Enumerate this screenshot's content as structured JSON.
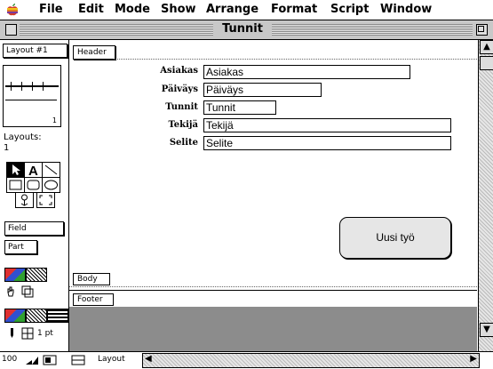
{
  "menubar": {
    "items": [
      "File",
      "Edit",
      "Mode",
      "Show",
      "Arrange",
      "Format",
      "Script",
      "Window"
    ]
  },
  "window": {
    "title": "Tunnit"
  },
  "tool_panel": {
    "layout_popup": "Layout #1",
    "thumbnail_page": "1",
    "layouts_label": "Layouts:",
    "layouts_count": "1",
    "field_button": "Field",
    "part_button": "Part",
    "line_width": "1 pt",
    "tools": [
      "pointer-tool",
      "text-tool",
      "line-tool",
      "rectangle-tool",
      "rounded-rectangle-tool",
      "oval-tool",
      "button-tool",
      "portal-tool"
    ]
  },
  "layout": {
    "header_tab": "Header",
    "body_tab": "Body",
    "footer_tab": "Footer",
    "fields": [
      {
        "label": "Asiakas",
        "value": "Asiakas"
      },
      {
        "label": "Päiväys",
        "value": "Päiväys"
      },
      {
        "label": "Tunnit",
        "value": "Tunnit"
      },
      {
        "label": "Tekijä",
        "value": "Tekijä"
      },
      {
        "label": "Selite",
        "value": "Selite"
      }
    ],
    "new_button_label": "Uusi työ"
  },
  "statusbar": {
    "zoom": "100",
    "mode": "Layout"
  },
  "colors": {
    "title_bar": "#c8c8c8",
    "button_fill": "#e6e6e6",
    "gray_area": "#8c8c8c"
  }
}
